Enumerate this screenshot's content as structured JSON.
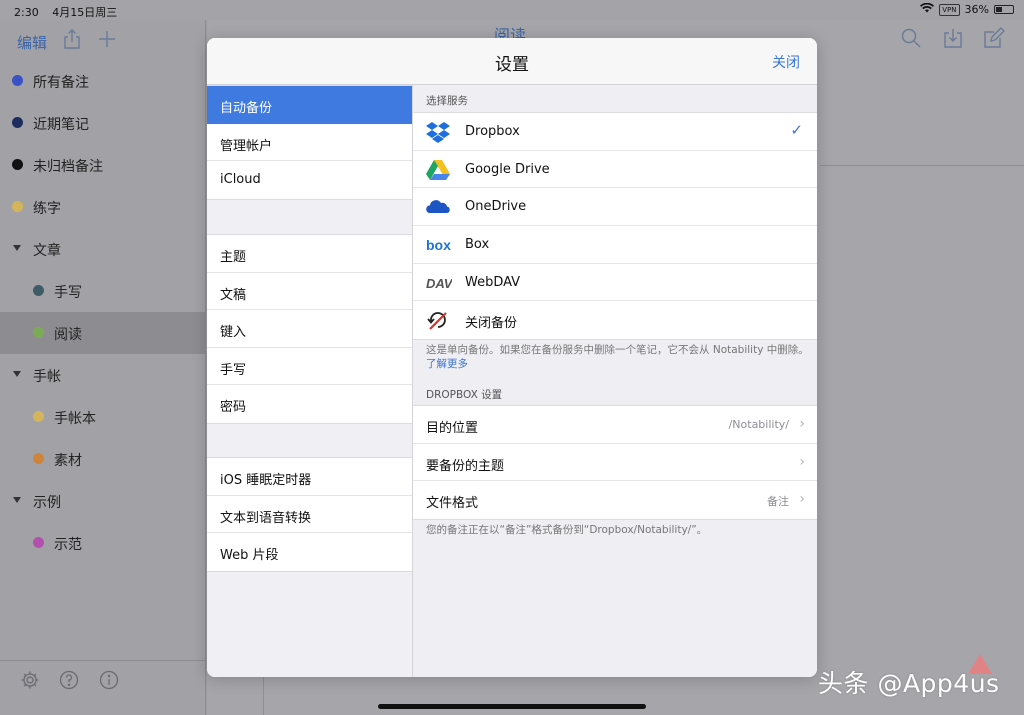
{
  "status_bar": {
    "time": "2:30",
    "date": "4月15日周三",
    "vpn": "VPN",
    "battery": "36%"
  },
  "background": {
    "edit_label": "编辑",
    "title": "阅读",
    "folders": [
      {
        "label": "所有备注",
        "color": "#3b52c4",
        "level": 0,
        "type": "dot"
      },
      {
        "label": "近期笔记",
        "color": "#1e2c5e",
        "level": 0,
        "type": "dot"
      },
      {
        "label": "未归档备注",
        "color": "#111111",
        "level": 0,
        "type": "dot"
      },
      {
        "label": "练字",
        "color": "#d4b55a",
        "level": 0,
        "type": "dot"
      },
      {
        "label": "文章",
        "level": 0,
        "type": "group"
      },
      {
        "label": "手写",
        "color": "#3e5c66",
        "level": 1,
        "type": "dot"
      },
      {
        "label": "阅读",
        "color": "#7bab55",
        "level": 1,
        "type": "dot",
        "selected": true
      },
      {
        "label": "手帐",
        "level": 0,
        "type": "group"
      },
      {
        "label": "手帐本",
        "color": "#d4b55a",
        "level": 1,
        "type": "dot"
      },
      {
        "label": "素材",
        "color": "#d0843a",
        "level": 1,
        "type": "dot"
      },
      {
        "label": "示例",
        "level": 0,
        "type": "group"
      },
      {
        "label": "示范",
        "color": "#b44fb0",
        "level": 1,
        "type": "dot"
      }
    ]
  },
  "modal": {
    "title": "设置",
    "close_label": "关闭",
    "menu_groups": [
      [
        "自动备份",
        "管理帐户",
        "iCloud"
      ],
      [
        "主题",
        "文稿",
        "键入",
        "手写",
        "密码"
      ],
      [
        "iOS 睡眠定时器",
        "文本到语音转换",
        "Web 片段"
      ]
    ],
    "active_menu": "自动备份",
    "services_header": "选择服务",
    "services": [
      {
        "label": "Dropbox",
        "icon": "dropbox-icon",
        "checked": true
      },
      {
        "label": "Google Drive",
        "icon": "google-drive-icon",
        "checked": false
      },
      {
        "label": "OneDrive",
        "icon": "onedrive-icon",
        "checked": false
      },
      {
        "label": "Box",
        "icon": "box-icon",
        "checked": false
      },
      {
        "label": "WebDAV",
        "icon": "webdav-icon",
        "checked": false
      },
      {
        "label": "关闭备份",
        "icon": "backup-off-icon",
        "checked": false
      }
    ],
    "check_mark": "✓",
    "services_note": "这是单向备份。如果您在备份服务中删除一个笔记，它不会从 Notability 中删除。",
    "learn_more": "了解更多",
    "dropbox_header": "DROPBOX 设置",
    "dropbox_settings": [
      {
        "label": "目的位置",
        "value": "/Notability/"
      },
      {
        "label": "要备份的主题",
        "value": ""
      },
      {
        "label": "文件格式",
        "value": "备注"
      }
    ],
    "dropbox_note": "您的备注正在以“备注”格式备份到“Dropbox/Notability/”。"
  },
  "watermark": "头条 @App4us",
  "colors": {
    "accent": "#3b76d6",
    "active_row": "#3e7ae0",
    "dropbox": "#1f6ee0"
  }
}
